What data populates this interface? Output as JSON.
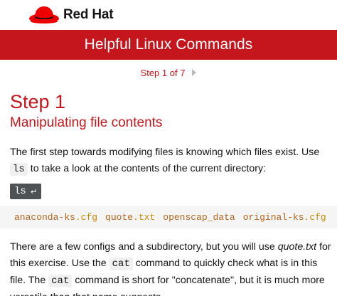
{
  "brand": {
    "name": "Red Hat",
    "logo_icon": "redhat-fedora-icon",
    "logo_color": "#ee0000"
  },
  "header": {
    "title": "Helpful Linux Commands",
    "bar_color": "#c4161c"
  },
  "step_nav": {
    "label": "Step 1 of 7",
    "next_icon": "chevron-right-icon"
  },
  "step": {
    "heading": "Step 1",
    "subheading": "Manipulating file contents"
  },
  "para1": {
    "part1": "The first step towards modifying files is knowing which files exist. Use ",
    "code": "ls",
    "part2": " to take a look at the contents of the current directory:"
  },
  "command": {
    "text": "ls",
    "enter_icon": "↵"
  },
  "output": {
    "files": [
      {
        "base": "anaconda-ks",
        "ext": ".cfg"
      },
      {
        "base": "quote",
        "ext": ".txt"
      },
      {
        "base": "openscap_data",
        "ext": ""
      },
      {
        "base": "original-ks",
        "ext": ".cfg"
      }
    ]
  },
  "para2": {
    "part1": "There are a few configs and a subdirectory, but you will use ",
    "em": "quote.txt",
    "part2": " for this exercise. Use the ",
    "code1": "cat",
    "part3": " command to quickly check what is in this file. The ",
    "code2": "cat",
    "part4": " command is short for \"concatenate\", but it is much more versatile than that name suggests."
  }
}
